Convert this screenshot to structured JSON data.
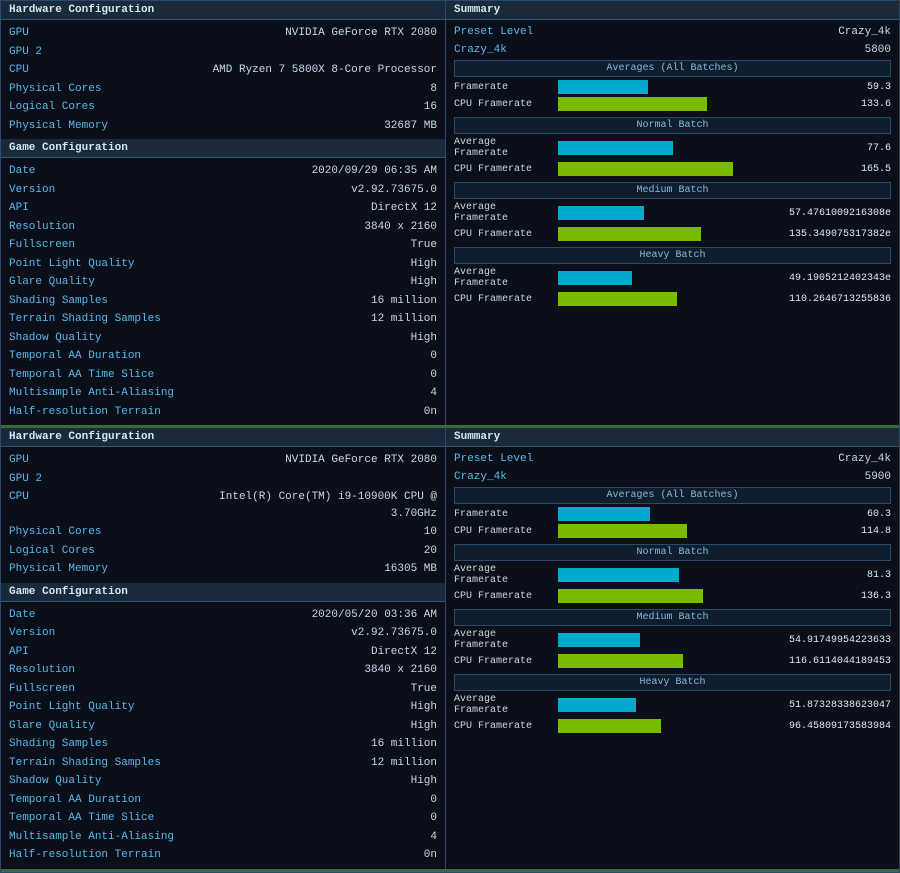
{
  "panels": [
    {
      "hardware": {
        "header": "Hardware Configuration",
        "rows": [
          {
            "label": "GPU",
            "value": "NVIDIA GeForce RTX 2080"
          },
          {
            "label": "GPU 2",
            "value": ""
          },
          {
            "label": "CPU",
            "value": "AMD Ryzen 7 5800X 8-Core Processor"
          },
          {
            "label": "Physical Cores",
            "value": "8"
          },
          {
            "label": "Logical Cores",
            "value": "16"
          },
          {
            "label": "Physical Memory",
            "value": "32687 MB"
          }
        ]
      },
      "game": {
        "header": "Game Configuration",
        "rows": [
          {
            "label": "Date",
            "value": "2020/09/29 06:35 AM"
          },
          {
            "label": "Version",
            "value": "v2.92.73675.0"
          },
          {
            "label": "API",
            "value": "DirectX 12"
          },
          {
            "label": "Resolution",
            "value": "3840 x 2160"
          },
          {
            "label": "Fullscreen",
            "value": "True"
          },
          {
            "label": "Point Light Quality",
            "value": "High"
          },
          {
            "label": "Glare Quality",
            "value": "High"
          },
          {
            "label": "Shading Samples",
            "value": "16 million"
          },
          {
            "label": "Terrain Shading Samples",
            "value": "12 million"
          },
          {
            "label": "Shadow Quality",
            "value": "High"
          },
          {
            "label": "Temporal AA Duration",
            "value": "0"
          },
          {
            "label": "Temporal AA Time Slice",
            "value": "0"
          },
          {
            "label": "Multisample Anti-Aliasing",
            "value": "4"
          },
          {
            "label": "Half-resolution Terrain",
            "value": "0n"
          }
        ]
      },
      "summary": {
        "header": "Summary",
        "preset_label": "Preset Level",
        "preset_value": "Crazy_4k",
        "preset_value2": "Crazy_4k",
        "preset_num": "5800",
        "batches": [
          {
            "header": "Averages (All Batches)",
            "rows": [
              {
                "label": "Framerate",
                "value": "59.3",
                "color": "cyan",
                "pct": 45
              },
              {
                "label": "CPU Framerate",
                "value": "133.6",
                "color": "green",
                "pct": 75
              }
            ]
          },
          {
            "header": "Normal Batch",
            "rows": [
              {
                "label": "Average Framerate",
                "value": "77.6",
                "color": "cyan",
                "pct": 58
              },
              {
                "label": "CPU Framerate",
                "value": "165.5",
                "color": "green",
                "pct": 88
              }
            ]
          },
          {
            "header": "Medium Batch",
            "rows": [
              {
                "label": "Average Framerate",
                "value": "57.4761009216308e",
                "color": "cyan",
                "pct": 43
              },
              {
                "label": "CPU Framerate",
                "value": "135.349075317382e",
                "color": "green",
                "pct": 72
              }
            ]
          },
          {
            "header": "Heavy Batch",
            "rows": [
              {
                "label": "Average Framerate",
                "value": "49.1905212402343e",
                "color": "cyan",
                "pct": 37
              },
              {
                "label": "CPU Framerate",
                "value": "110.2646713255836",
                "color": "green",
                "pct": 60
              }
            ]
          }
        ]
      }
    },
    {
      "hardware": {
        "header": "Hardware Configuration",
        "rows": [
          {
            "label": "GPU",
            "value": "NVIDIA GeForce RTX 2080"
          },
          {
            "label": "GPU 2",
            "value": ""
          },
          {
            "label": "CPU",
            "value": "Intel(R) Core(TM) i9-10900K CPU @ 3.70GHz"
          },
          {
            "label": "Physical Cores",
            "value": "10"
          },
          {
            "label": "Logical Cores",
            "value": "20"
          },
          {
            "label": "Physical Memory",
            "value": "16305 MB"
          }
        ]
      },
      "game": {
        "header": "Game Configuration",
        "rows": [
          {
            "label": "Date",
            "value": "2020/05/20 03:36 AM"
          },
          {
            "label": "Version",
            "value": "v2.92.73675.0"
          },
          {
            "label": "API",
            "value": "DirectX 12"
          },
          {
            "label": "Resolution",
            "value": "3840 x 2160"
          },
          {
            "label": "Fullscreen",
            "value": "True"
          },
          {
            "label": "Point Light Quality",
            "value": "High"
          },
          {
            "label": "Glare Quality",
            "value": "High"
          },
          {
            "label": "Shading Samples",
            "value": "16 million"
          },
          {
            "label": "Terrain Shading Samples",
            "value": "12 million"
          },
          {
            "label": "Shadow Quality",
            "value": "High"
          },
          {
            "label": "Temporal AA Duration",
            "value": "0"
          },
          {
            "label": "Temporal AA Time Slice",
            "value": "0"
          },
          {
            "label": "Multisample Anti-Aliasing",
            "value": "4"
          },
          {
            "label": "Half-resolution Terrain",
            "value": "0n"
          }
        ]
      },
      "summary": {
        "header": "Summary",
        "preset_label": "Preset Level",
        "preset_value": "Crazy_4k",
        "preset_value2": "Crazy_4k",
        "preset_num": "5900",
        "batches": [
          {
            "header": "Averages (All Batches)",
            "rows": [
              {
                "label": "Framerate",
                "value": "60.3",
                "color": "cyan",
                "pct": 46
              },
              {
                "label": "CPU Framerate",
                "value": "114.8",
                "color": "green",
                "pct": 65
              }
            ]
          },
          {
            "header": "Normal Batch",
            "rows": [
              {
                "label": "Average Framerate",
                "value": "81.3",
                "color": "cyan",
                "pct": 61
              },
              {
                "label": "CPU Framerate",
                "value": "136.3",
                "color": "green",
                "pct": 73
              }
            ]
          },
          {
            "header": "Medium Batch",
            "rows": [
              {
                "label": "Average Framerate",
                "value": "54.91749954223633",
                "color": "cyan",
                "pct": 41
              },
              {
                "label": "CPU Framerate",
                "value": "116.6114044189453",
                "color": "green",
                "pct": 63
              }
            ]
          },
          {
            "header": "Heavy Batch",
            "rows": [
              {
                "label": "Average Framerate",
                "value": "51.87328338623047",
                "color": "cyan",
                "pct": 39
              },
              {
                "label": "CPU Framerate",
                "value": "96.45809173583984",
                "color": "green",
                "pct": 52
              }
            ]
          }
        ]
      }
    }
  ]
}
